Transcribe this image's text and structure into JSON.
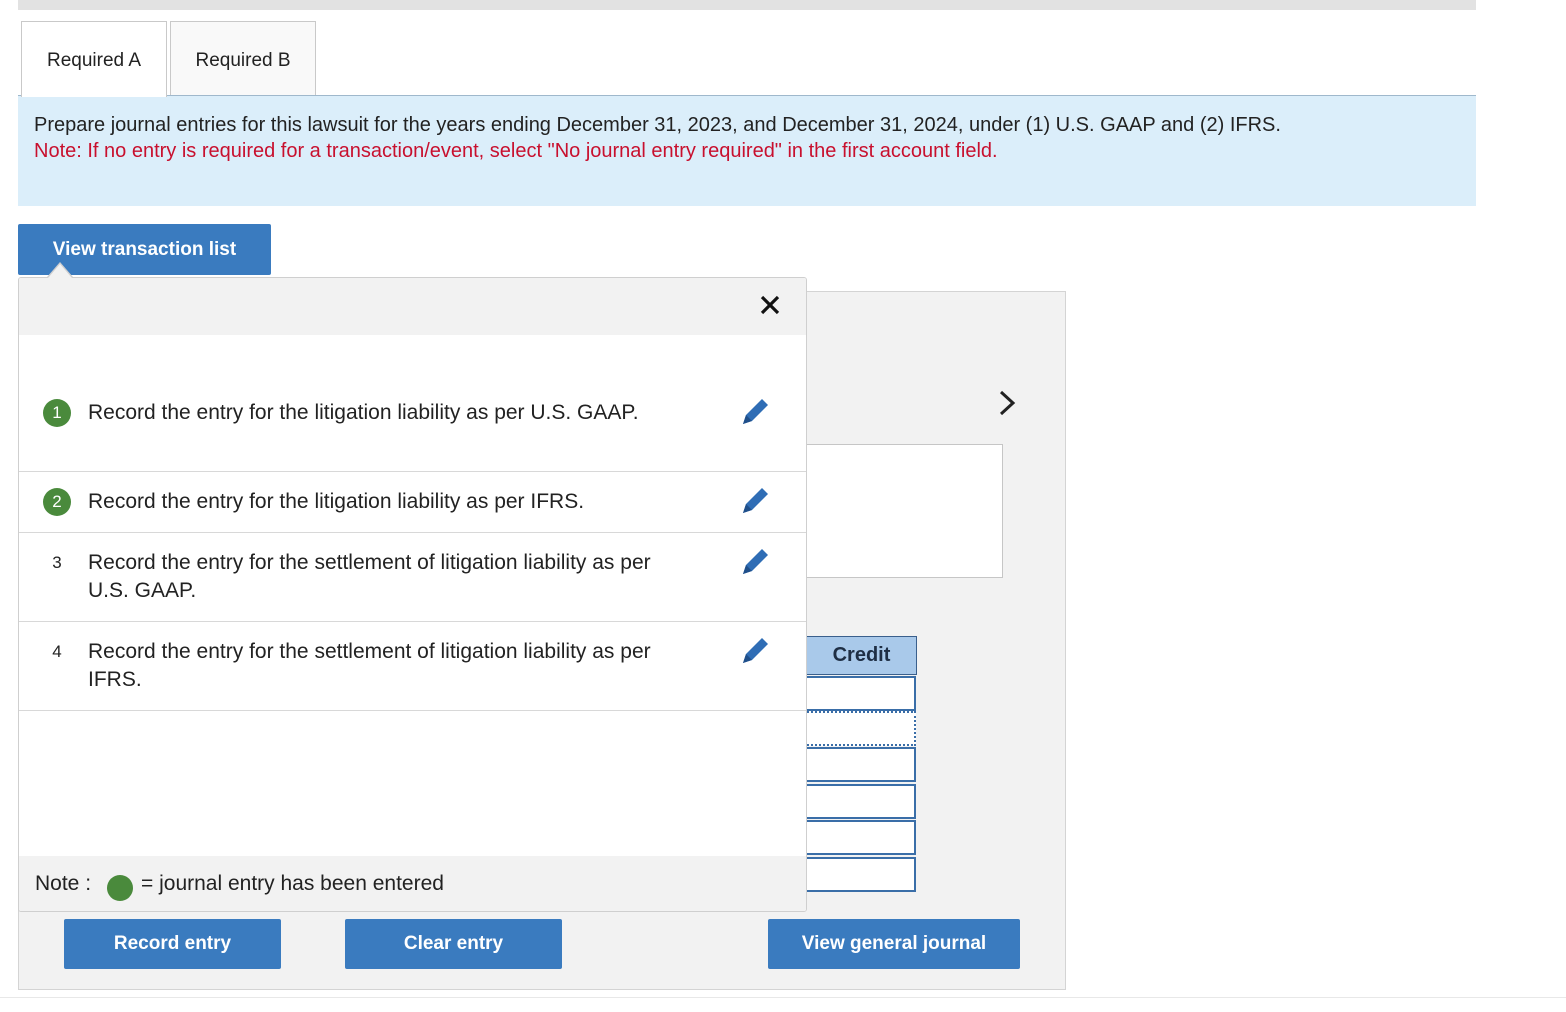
{
  "tabs": [
    {
      "label": "Required A",
      "active": true
    },
    {
      "label": "Required B",
      "active": false
    }
  ],
  "instructions": {
    "main": "Prepare journal entries for this lawsuit for the years ending December 31, 2023, and December 31, 2024, under (1) U.S. GAAP and (2) IFRS.",
    "note": "Note: If no entry is required for a transaction/event, select \"No journal entry required\" in the first account field."
  },
  "buttons": {
    "view_transaction_list": "View transaction list",
    "record_entry": "Record entry",
    "clear_entry": "Clear entry",
    "view_general_journal": "View general journal"
  },
  "popup": {
    "close_icon": "close-icon",
    "transactions": [
      {
        "number": "1",
        "text": "Record the entry for the litigation liability as per U.S. GAAP.",
        "entered": true
      },
      {
        "number": "2",
        "text": "Record the entry for the litigation liability as per IFRS.",
        "entered": true
      },
      {
        "number": "3",
        "text": "Record the entry for the settlement of litigation liability as per U.S. GAAP.",
        "entered": false
      },
      {
        "number": "4",
        "text": "Record the entry for the settlement of litigation liability as per IFRS.",
        "entered": false
      }
    ],
    "note": {
      "label": "Note :",
      "text": "= journal entry has been entered"
    }
  },
  "journal": {
    "credit_header": "Credit"
  },
  "colors": {
    "accent": "#3a7bbf",
    "entered": "#4a8a3c",
    "note_red": "#c8102e",
    "instructions_bg": "#dbeefa"
  }
}
